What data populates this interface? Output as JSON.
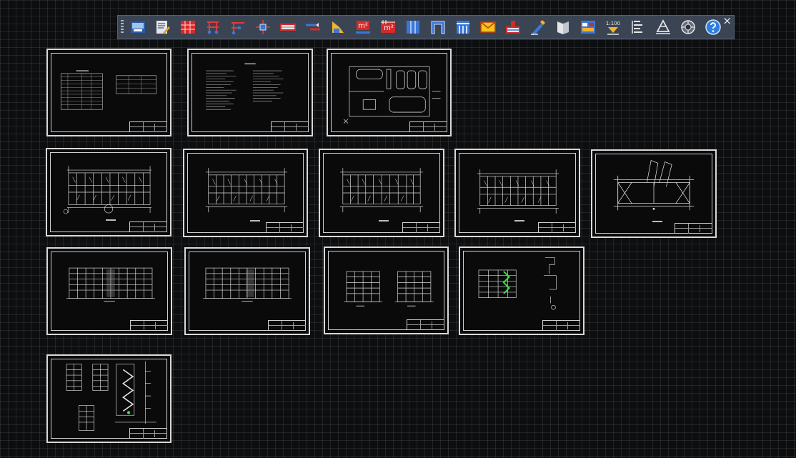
{
  "toolbar": {
    "tools": [
      {
        "name": "axis-grid-tool"
      },
      {
        "name": "text-edit-tool"
      },
      {
        "name": "grid-tool"
      },
      {
        "name": "column-tool"
      },
      {
        "name": "beam-tool"
      },
      {
        "name": "node-tool"
      },
      {
        "name": "wall-tool"
      },
      {
        "name": "door-tool"
      },
      {
        "name": "room-tool"
      },
      {
        "name": "area-tool",
        "label": "m²"
      },
      {
        "name": "area-table-tool",
        "label": "m²"
      },
      {
        "name": "elevation-tool"
      },
      {
        "name": "section-tool"
      },
      {
        "name": "facade-tool"
      },
      {
        "name": "envelope-tool"
      },
      {
        "name": "stamp-tool"
      },
      {
        "name": "pen-tool"
      },
      {
        "name": "book-tool"
      },
      {
        "name": "layer-tool"
      },
      {
        "name": "scale-tool",
        "label": "1:100"
      },
      {
        "name": "text-tool"
      },
      {
        "name": "dimension-tool"
      },
      {
        "name": "layer-manager-tool"
      },
      {
        "name": "help-tool"
      }
    ],
    "close_label": "×"
  },
  "sheets": [
    {
      "name": "sheet-table"
    },
    {
      "name": "sheet-notes"
    },
    {
      "name": "sheet-site"
    },
    {
      "name": "sheet-plan-1"
    },
    {
      "name": "sheet-plan-2"
    },
    {
      "name": "sheet-plan-3"
    },
    {
      "name": "sheet-plan-4"
    },
    {
      "name": "sheet-roof"
    },
    {
      "name": "sheet-elevation-1"
    },
    {
      "name": "sheet-elevation-2"
    },
    {
      "name": "sheet-side-elevations"
    },
    {
      "name": "sheet-section"
    },
    {
      "name": "sheet-stair-details"
    }
  ],
  "colors": {
    "background": "#0d0e10",
    "toolbar": "#3b4453",
    "line": "#d8d8d8",
    "accent_green": "#3de04a"
  }
}
